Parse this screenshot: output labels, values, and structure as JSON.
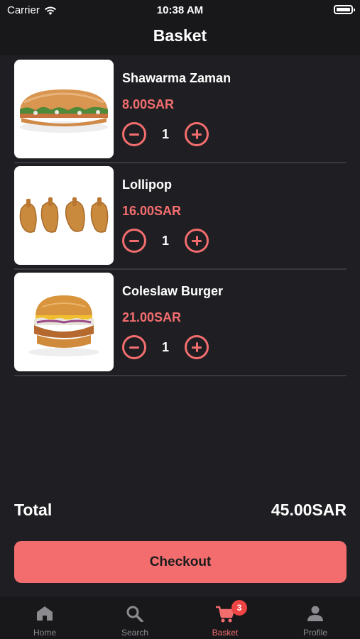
{
  "status_bar": {
    "carrier": "Carrier",
    "time": "10:38 AM"
  },
  "header": {
    "title": "Basket"
  },
  "items": [
    {
      "name": "Shawarma Zaman",
      "price": "8.00SAR",
      "quantity": "1",
      "image": "shawarma-sandwich"
    },
    {
      "name": "Lollipop",
      "price": "16.00SAR",
      "quantity": "1",
      "image": "fried-chicken-lollipops"
    },
    {
      "name": "Coleslaw Burger",
      "price": "21.00SAR",
      "quantity": "1",
      "image": "coleslaw-burger"
    }
  ],
  "summary": {
    "total_label": "Total",
    "total_value": "45.00SAR"
  },
  "checkout_label": "Checkout",
  "tabs": [
    {
      "label": "Home",
      "icon": "home-icon",
      "active": false
    },
    {
      "label": "Search",
      "icon": "search-icon",
      "active": false
    },
    {
      "label": "Basket",
      "icon": "cart-icon",
      "active": true,
      "badge": "3"
    },
    {
      "label": "Profile",
      "icon": "person-icon",
      "active": false
    }
  ],
  "colors": {
    "accent": "#f36d6e",
    "background": "#1f1f23",
    "bar": "#18181b",
    "badge": "#ef4444"
  }
}
